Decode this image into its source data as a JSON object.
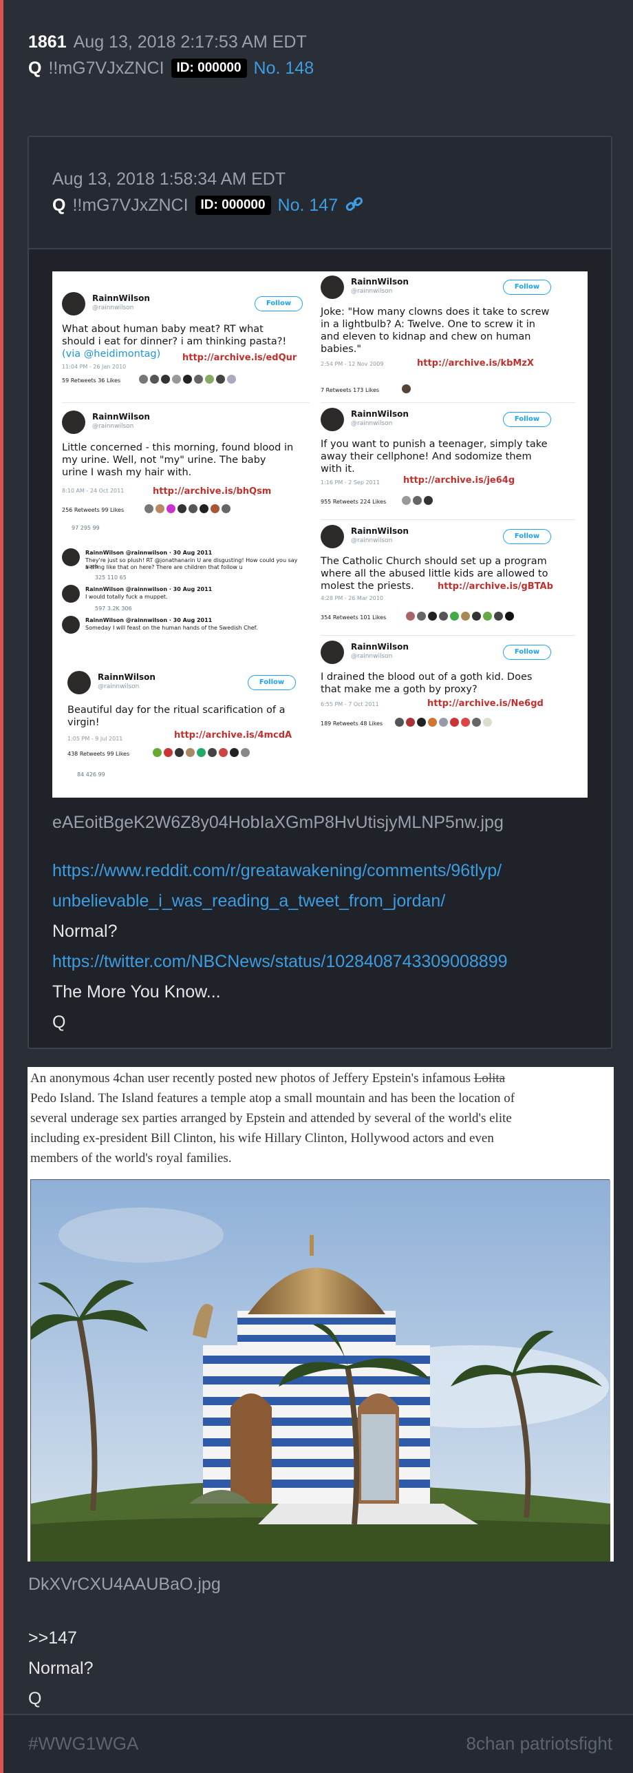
{
  "post": {
    "number": "1861",
    "date": "Aug 13, 2018 2:17:53 AM EDT",
    "author_q": "Q",
    "tripcode": "!!mG7VJxZNCI",
    "id_badge": "ID: 000000",
    "post_no": "No. 148"
  },
  "quoted": {
    "date": "Aug 13, 2018 1:58:34 AM EDT",
    "author_q": "Q",
    "tripcode": "!!mG7VJxZNCI",
    "id_badge": "ID: 000000",
    "post_no": "No. 147",
    "link_icon": "link-icon",
    "image_filename": "eAEoitBgeK2W6Z8y04HobIaXGmP8HvUtisjyMLNP5nw.jpg",
    "lines": {
      "url1_a": "https://www.reddit.com/r/greatawakening/comments/96tlyp/",
      "url1_b": "unbelievable_i_was_reading_a_tweet_from_jordan/",
      "text1": "Normal?",
      "url2": "https://twitter.com/NBCNews/status/1028408743309008899",
      "text2": "The More You Know...",
      "text3": "Q"
    },
    "tweets": {
      "name": "RainnWilson",
      "handle": "@rainnwilson",
      "follow": "Follow",
      "t1_text_a": "What about human baby meat? RT what",
      "t1_text_b": "should i eat for dinner? i am thinking pasta?!",
      "t1_text_c": "(via @heidimontag)",
      "t1_time": "11:04 PM - 26 Jan 2010",
      "t1_stats": "59 Retweets   36 Likes",
      "t1_archive": "http://archive.is/edQur",
      "t2_text_a": "Little concerned - this morning, found blood in",
      "t2_text_b": "my urine. Well, not \"my\" urine. The baby",
      "t2_text_c": "urine I wash my hair with.",
      "t2_time": "8:10 AM - 24 Oct 2011",
      "t2_stats": "256 Retweets   99 Likes",
      "t2_archive": "http://archive.is/bhQsm",
      "t2_counts": "97       295       99",
      "r1_head": "RainnWilson @rainnwilson · 30 Aug 2011",
      "r1_text_a": "They're just so plush! RT @jonathanarin U are disgusting! How could you say such",
      "r1_text_b": "a thing like that on here? There are children that follow u",
      "r1_counts": "325       110       65",
      "r2_head": "RainnWilson @rainnwilson · 30 Aug 2011",
      "r2_text": "I would totally fuck a muppet.",
      "r2_counts": "597       3.2K       306",
      "r3_head": "RainnWilson @rainnwilson · 30 Aug 2011",
      "r3_text": "Someday I will feast on the human hands of the Swedish Chef.",
      "t3_text_a": "Beautiful day for the ritual scarification of a",
      "t3_text_b": "virgin!",
      "t3_time": "1:05 PM - 9 Jul 2011",
      "t3_stats": "438 Retweets   99 Likes",
      "t3_archive": "http://archive.is/4mcdA",
      "t3_counts": "84       426       99",
      "t4_text_a": "Joke: \"How many clowns does it take to screw",
      "t4_text_b": "in a lightbulb? A: Twelve. One to screw it in",
      "t4_text_c": "and eleven to kidnap and chew on human",
      "t4_text_d": "babies.\"",
      "t4_time": "2:54 PM - 12 Nov 2009",
      "t4_stats": "7 Retweets   173 Likes",
      "t4_archive": "http://archive.is/kbMzX",
      "t5_text_a": "If you want to punish a teenager, simply take",
      "t5_text_b": "away their cellphone!  And sodomize them",
      "t5_text_c": "with it.",
      "t5_time": "1:16 PM - 2 Sep 2011",
      "t5_stats": "955 Retweets   224 Likes",
      "t5_archive": "http://archive.is/je64g",
      "t6_text_a": "The Catholic Church should set up a program",
      "t6_text_b": "where all the abused little kids are allowed to",
      "t6_text_c": "molest the priests.",
      "t6_time": "4:28 PM - 26 Mar 2010",
      "t6_stats": "354 Retweets   101 Likes",
      "t6_archive": "http://archive.is/gBTAb",
      "t7_text_a": "I drained the blood out of a goth kid.  Does",
      "t7_text_b": "that make me a goth by proxy?",
      "t7_time": "6:55 PM - 7 Oct 2011",
      "t7_stats": "189 Retweets   48 Likes",
      "t7_archive": "http://archive.is/Ne6gd"
    }
  },
  "article": {
    "text_a": "An anonymous 4chan user recently posted new photos of Jeffery Epstein's infamous",
    "text_strike": "Lolita",
    "text_b": "Pedo Island. The Island features a temple atop a small mountain and has been the location of",
    "text_c": "several underage sex parties arranged by Epstein and attended by several of the world's elite",
    "text_d": "including ex-president Bill Clinton, his wife Hillary Clinton, Hollywood actors and even",
    "text_e": "members of the world's royal families.",
    "image_filename": "DkXVrCXU4AAUBaO.jpg"
  },
  "reply": {
    "quote_ref": ">>147",
    "line1": "Normal?",
    "line2": "Q"
  },
  "footer": {
    "hashtag": "#WWG1WGA",
    "board": "8chan patriotsfight"
  },
  "colors": {
    "accent_link": "#3d9de0",
    "side_bar": "#d9534f",
    "background": "#2a2e37"
  }
}
